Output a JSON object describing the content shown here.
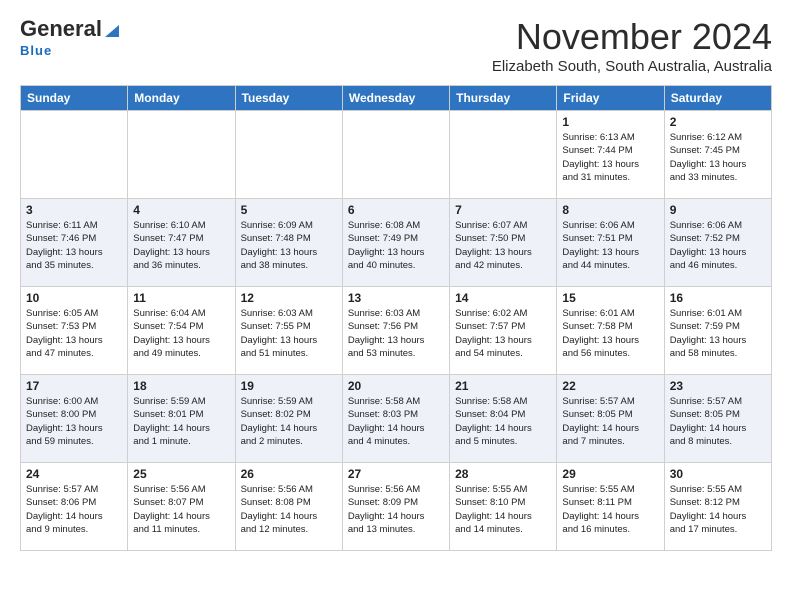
{
  "header": {
    "logo_main": "General",
    "logo_sub": "Blue",
    "month": "November 2024",
    "location": "Elizabeth South, South Australia, Australia"
  },
  "days_of_week": [
    "Sunday",
    "Monday",
    "Tuesday",
    "Wednesday",
    "Thursday",
    "Friday",
    "Saturday"
  ],
  "weeks": [
    [
      {
        "day": null,
        "info": null
      },
      {
        "day": null,
        "info": null
      },
      {
        "day": null,
        "info": null
      },
      {
        "day": null,
        "info": null
      },
      {
        "day": null,
        "info": null
      },
      {
        "day": "1",
        "info": "Sunrise: 6:13 AM\nSunset: 7:44 PM\nDaylight: 13 hours\nand 31 minutes."
      },
      {
        "day": "2",
        "info": "Sunrise: 6:12 AM\nSunset: 7:45 PM\nDaylight: 13 hours\nand 33 minutes."
      }
    ],
    [
      {
        "day": "3",
        "info": "Sunrise: 6:11 AM\nSunset: 7:46 PM\nDaylight: 13 hours\nand 35 minutes."
      },
      {
        "day": "4",
        "info": "Sunrise: 6:10 AM\nSunset: 7:47 PM\nDaylight: 13 hours\nand 36 minutes."
      },
      {
        "day": "5",
        "info": "Sunrise: 6:09 AM\nSunset: 7:48 PM\nDaylight: 13 hours\nand 38 minutes."
      },
      {
        "day": "6",
        "info": "Sunrise: 6:08 AM\nSunset: 7:49 PM\nDaylight: 13 hours\nand 40 minutes."
      },
      {
        "day": "7",
        "info": "Sunrise: 6:07 AM\nSunset: 7:50 PM\nDaylight: 13 hours\nand 42 minutes."
      },
      {
        "day": "8",
        "info": "Sunrise: 6:06 AM\nSunset: 7:51 PM\nDaylight: 13 hours\nand 44 minutes."
      },
      {
        "day": "9",
        "info": "Sunrise: 6:06 AM\nSunset: 7:52 PM\nDaylight: 13 hours\nand 46 minutes."
      }
    ],
    [
      {
        "day": "10",
        "info": "Sunrise: 6:05 AM\nSunset: 7:53 PM\nDaylight: 13 hours\nand 47 minutes."
      },
      {
        "day": "11",
        "info": "Sunrise: 6:04 AM\nSunset: 7:54 PM\nDaylight: 13 hours\nand 49 minutes."
      },
      {
        "day": "12",
        "info": "Sunrise: 6:03 AM\nSunset: 7:55 PM\nDaylight: 13 hours\nand 51 minutes."
      },
      {
        "day": "13",
        "info": "Sunrise: 6:03 AM\nSunset: 7:56 PM\nDaylight: 13 hours\nand 53 minutes."
      },
      {
        "day": "14",
        "info": "Sunrise: 6:02 AM\nSunset: 7:57 PM\nDaylight: 13 hours\nand 54 minutes."
      },
      {
        "day": "15",
        "info": "Sunrise: 6:01 AM\nSunset: 7:58 PM\nDaylight: 13 hours\nand 56 minutes."
      },
      {
        "day": "16",
        "info": "Sunrise: 6:01 AM\nSunset: 7:59 PM\nDaylight: 13 hours\nand 58 minutes."
      }
    ],
    [
      {
        "day": "17",
        "info": "Sunrise: 6:00 AM\nSunset: 8:00 PM\nDaylight: 13 hours\nand 59 minutes."
      },
      {
        "day": "18",
        "info": "Sunrise: 5:59 AM\nSunset: 8:01 PM\nDaylight: 14 hours\nand 1 minute."
      },
      {
        "day": "19",
        "info": "Sunrise: 5:59 AM\nSunset: 8:02 PM\nDaylight: 14 hours\nand 2 minutes."
      },
      {
        "day": "20",
        "info": "Sunrise: 5:58 AM\nSunset: 8:03 PM\nDaylight: 14 hours\nand 4 minutes."
      },
      {
        "day": "21",
        "info": "Sunrise: 5:58 AM\nSunset: 8:04 PM\nDaylight: 14 hours\nand 5 minutes."
      },
      {
        "day": "22",
        "info": "Sunrise: 5:57 AM\nSunset: 8:05 PM\nDaylight: 14 hours\nand 7 minutes."
      },
      {
        "day": "23",
        "info": "Sunrise: 5:57 AM\nSunset: 8:05 PM\nDaylight: 14 hours\nand 8 minutes."
      }
    ],
    [
      {
        "day": "24",
        "info": "Sunrise: 5:57 AM\nSunset: 8:06 PM\nDaylight: 14 hours\nand 9 minutes."
      },
      {
        "day": "25",
        "info": "Sunrise: 5:56 AM\nSunset: 8:07 PM\nDaylight: 14 hours\nand 11 minutes."
      },
      {
        "day": "26",
        "info": "Sunrise: 5:56 AM\nSunset: 8:08 PM\nDaylight: 14 hours\nand 12 minutes."
      },
      {
        "day": "27",
        "info": "Sunrise: 5:56 AM\nSunset: 8:09 PM\nDaylight: 14 hours\nand 13 minutes."
      },
      {
        "day": "28",
        "info": "Sunrise: 5:55 AM\nSunset: 8:10 PM\nDaylight: 14 hours\nand 14 minutes."
      },
      {
        "day": "29",
        "info": "Sunrise: 5:55 AM\nSunset: 8:11 PM\nDaylight: 14 hours\nand 16 minutes."
      },
      {
        "day": "30",
        "info": "Sunrise: 5:55 AM\nSunset: 8:12 PM\nDaylight: 14 hours\nand 17 minutes."
      }
    ]
  ]
}
